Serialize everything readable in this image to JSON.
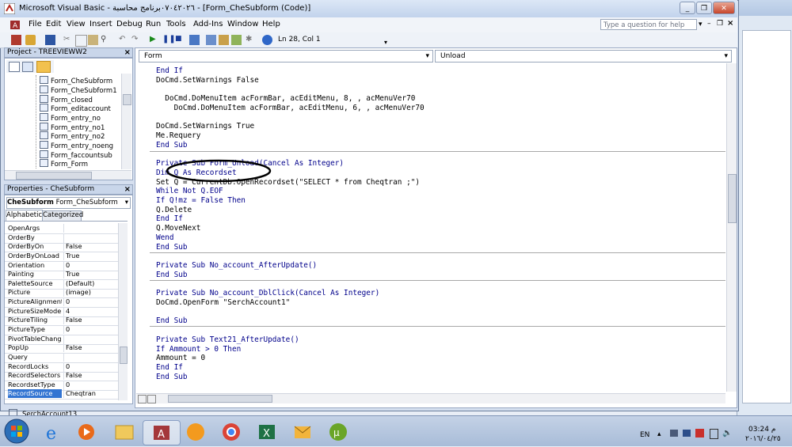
{
  "window": {
    "title": "Microsoft Visual Basic - ٠٧٠٤٢٠٢٦برنامج محاسبة - [Form_CheSubform (Code)]"
  },
  "menu": [
    "File",
    "Edit",
    "View",
    "Insert",
    "Debug",
    "Run",
    "Tools",
    "Add-Ins",
    "Window",
    "Help"
  ],
  "help_placeholder": "Type a question for help",
  "toolbar": {
    "position": "Ln 28, Col 1"
  },
  "project": {
    "title": "Project - TREEVIEWW2",
    "items": [
      "Form_CheSubform",
      "Form_CheSubform1",
      "Form_closed",
      "Form_editaccount",
      "Form_entry_no",
      "Form_entry_no1",
      "Form_entry_no2",
      "Form_entry_noeng",
      "Form_faccountsub",
      "Form_Form"
    ]
  },
  "properties": {
    "title": "Properties - CheSubform",
    "object_name": "CheSubform",
    "object_type": "Form_CheSubform",
    "tabs": [
      "Alphabetic",
      "Categorized"
    ],
    "rows": [
      {
        "name": "OpenArgs",
        "value": ""
      },
      {
        "name": "OrderBy",
        "value": ""
      },
      {
        "name": "OrderByOn",
        "value": "False"
      },
      {
        "name": "OrderByOnLoad",
        "value": "True"
      },
      {
        "name": "Orientation",
        "value": "0"
      },
      {
        "name": "Painting",
        "value": "True"
      },
      {
        "name": "PaletteSource",
        "value": "(Default)"
      },
      {
        "name": "Picture",
        "value": "(image)"
      },
      {
        "name": "PictureAlignment",
        "value": "0"
      },
      {
        "name": "PictureSizeMode",
        "value": "4"
      },
      {
        "name": "PictureTiling",
        "value": "False"
      },
      {
        "name": "PictureType",
        "value": "0"
      },
      {
        "name": "PivotTableChange",
        "value": ""
      },
      {
        "name": "PopUp",
        "value": "False"
      },
      {
        "name": "Query",
        "value": ""
      },
      {
        "name": "RecordLocks",
        "value": "0"
      },
      {
        "name": "RecordSelectors",
        "value": "False"
      },
      {
        "name": "RecordsetType",
        "value": "0"
      },
      {
        "name": "RecordSource",
        "value": "Cheqtran"
      }
    ]
  },
  "code": {
    "object": "Form",
    "procedure": "Unload",
    "lines": [
      "End If",
      "DoCmd.SetWarnings False",
      "",
      "  DoCmd.DoMenuItem acFormBar, acEditMenu, 8, , acMenuVer70",
      "    DoCmd.DoMenuItem acFormBar, acEditMenu, 6, , acMenuVer70",
      "",
      "DoCmd.SetWarnings True",
      "Me.Requery",
      "End Sub",
      "",
      "Private Sub Form_Unload(Cancel As Integer)",
      "Dim Q As Recordset",
      "Set Q = CurrentDb.OpenRecordset(\"SELECT * from Cheqtran ;\")",
      "While Not Q.EOF",
      "If Q!mz = False Then",
      "Q.Delete",
      "End If",
      "Q.MoveNext",
      "Wend",
      "End Sub",
      "",
      "Private Sub No_account_AfterUpdate()",
      "End Sub",
      "",
      "Private Sub No_account_DblClick(Cancel As Integer)",
      "DoCmd.OpenForm \"SerchAccount1\"",
      "",
      "End Sub",
      "",
      "Private Sub Text21_AfterUpdate()",
      "If Ammount > 0 Then",
      "Ammount = 0",
      "End If",
      "End Sub"
    ]
  },
  "bottom_item": "SerchAccount13",
  "taskbar": {
    "lang": "EN",
    "time": "03:24 م",
    "date": "٢٠١٦/٠٤/٢٥"
  },
  "colors": {
    "keyword": "#00008b",
    "selection": "#3274d2"
  }
}
